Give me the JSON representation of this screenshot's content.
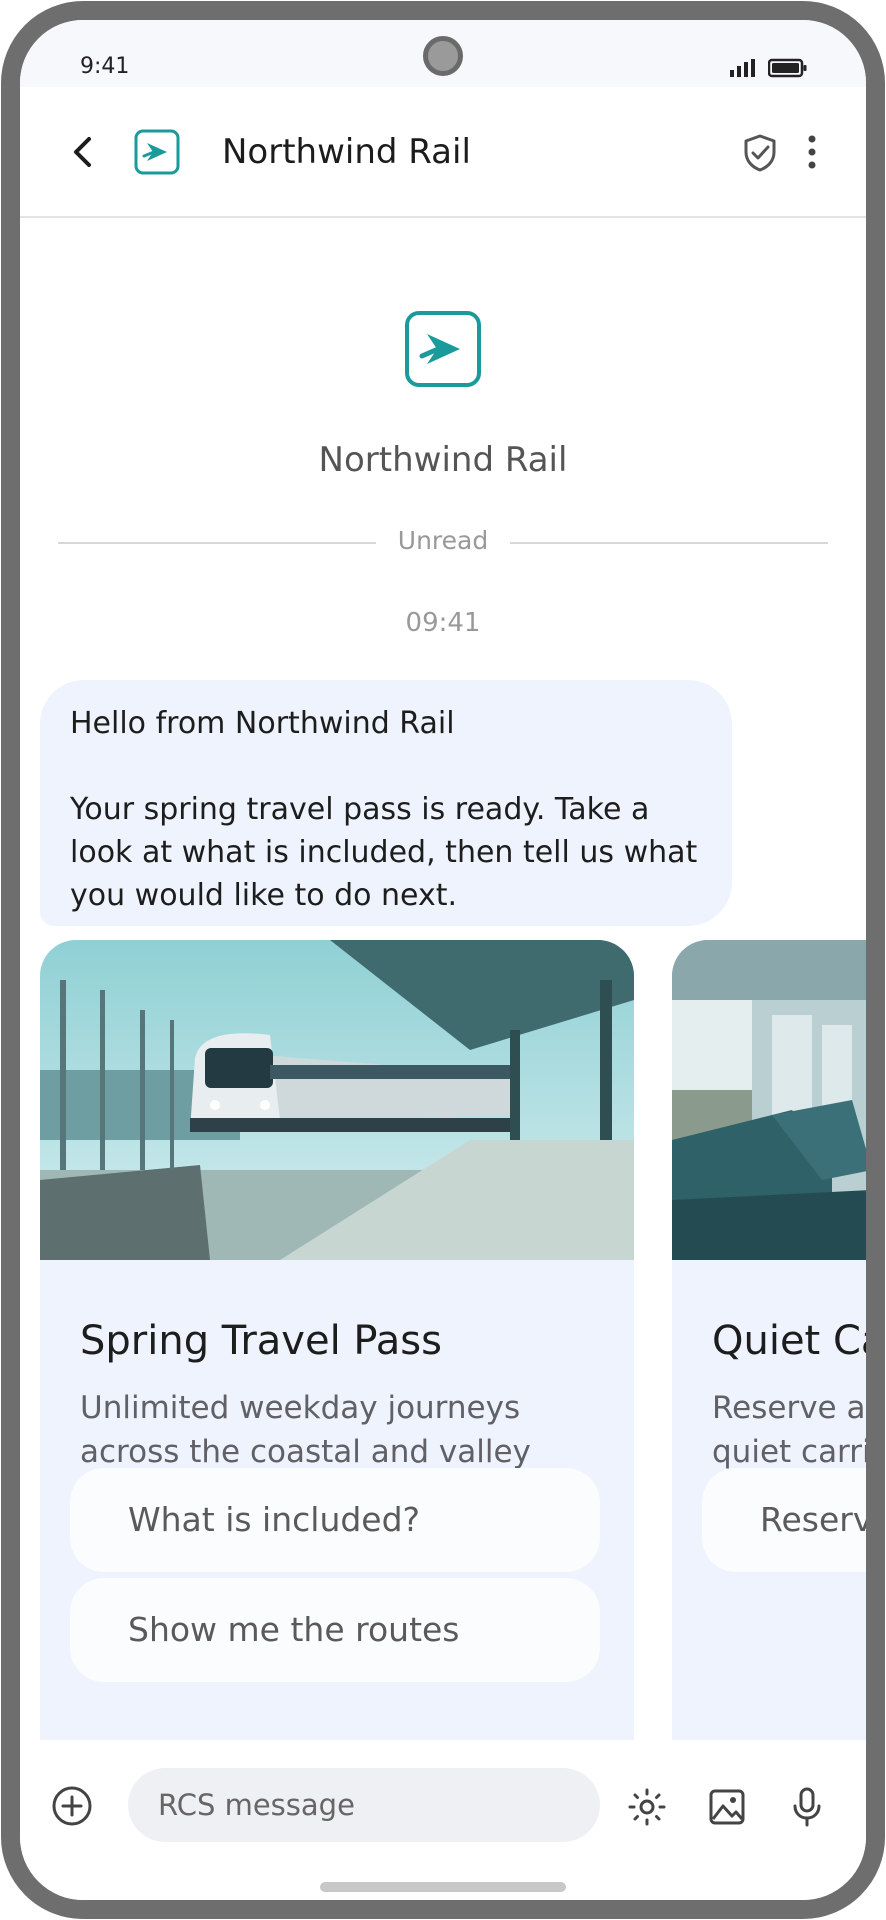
{
  "status_bar": {
    "time": "9:41"
  },
  "header": {
    "title": "Northwind Rail"
  },
  "brand": {
    "name": "Northwind Rail",
    "accent": "#1a9a9a"
  },
  "divider": {
    "label": "Unread"
  },
  "timestamp": "09:41",
  "message": {
    "line1": "Hello from Northwind Rail",
    "line2": "Your spring travel pass is ready. Take a look at what is included, then tell us what you would like to do next."
  },
  "cards": [
    {
      "title": "Spring Travel Pass",
      "description": "Unlimited weekday journeys across the coastal and valley lines for one flat monthly fare.",
      "actions": [
        "What is included?",
        "Show me the routes"
      ]
    },
    {
      "title": "Quiet Ca",
      "description": "Reserve a quiet carri when you",
      "actions": [
        "Reserv"
      ]
    }
  ],
  "composer": {
    "placeholder": "RCS message"
  },
  "colors": {
    "bubble": "#eef3fd",
    "frame": "#6e6e6e",
    "teal": "#1a9a9a"
  }
}
